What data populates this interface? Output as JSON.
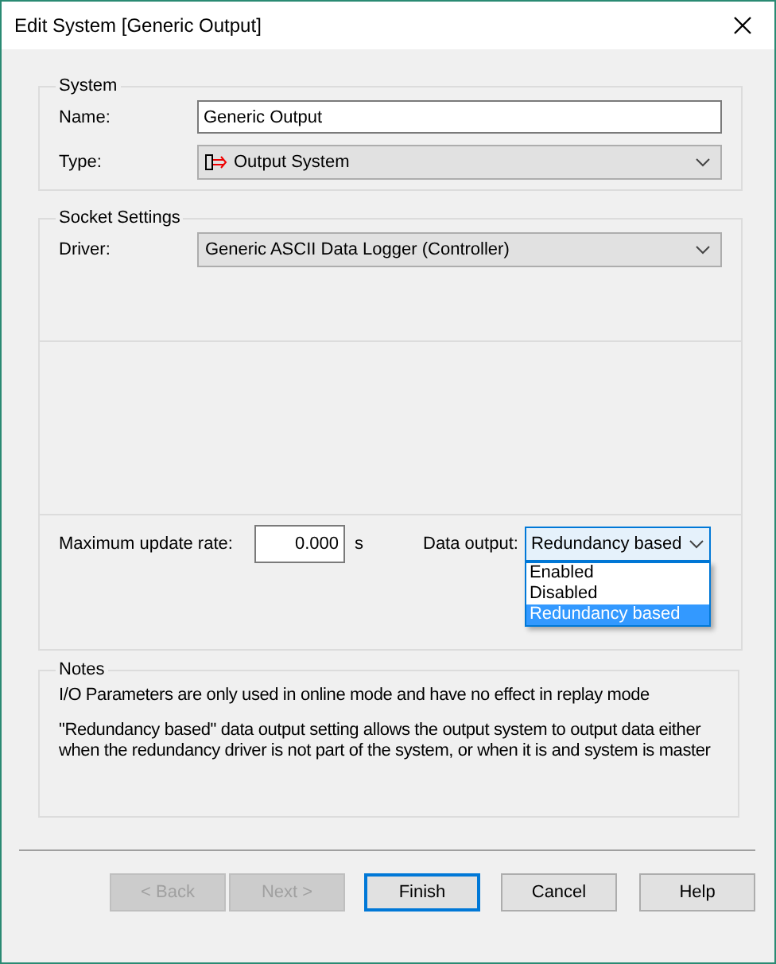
{
  "window": {
    "title": "Edit System [Generic Output]"
  },
  "system": {
    "title": "System",
    "name_label": "Name:",
    "name_value": "Generic Output",
    "type_label": "Type:",
    "type_value": "Output System"
  },
  "socket": {
    "title": "Socket Settings",
    "driver_label": "Driver:",
    "driver_value": "Generic ASCII Data Logger (Controller)",
    "rate_label": "Maximum update rate:",
    "rate_value": "0.000",
    "rate_unit": "s",
    "output_label": "Data output:",
    "output_value": "Redundancy based",
    "output_expanded": true,
    "options": [
      {
        "label": "Enabled",
        "selected": false
      },
      {
        "label": "Disabled",
        "selected": false
      },
      {
        "label": "Redundancy based",
        "selected": true
      }
    ]
  },
  "notes": {
    "title": "Notes",
    "lines": [
      "I/O Parameters are only used in online mode and have no effect in replay mode",
      "\"Redundancy based\" data output setting allows the output system to output data either when the redundancy driver is not part of the system, or when it is and system is master"
    ]
  },
  "buttons": [
    {
      "label": "< Back",
      "disabled": true,
      "default": false
    },
    {
      "label": "Next >",
      "disabled": true,
      "default": false
    },
    {
      "label": "Finish",
      "disabled": false,
      "default": true
    },
    {
      "label": "Cancel",
      "disabled": false,
      "default": false
    },
    {
      "label": "Help",
      "disabled": false,
      "default": false
    }
  ]
}
